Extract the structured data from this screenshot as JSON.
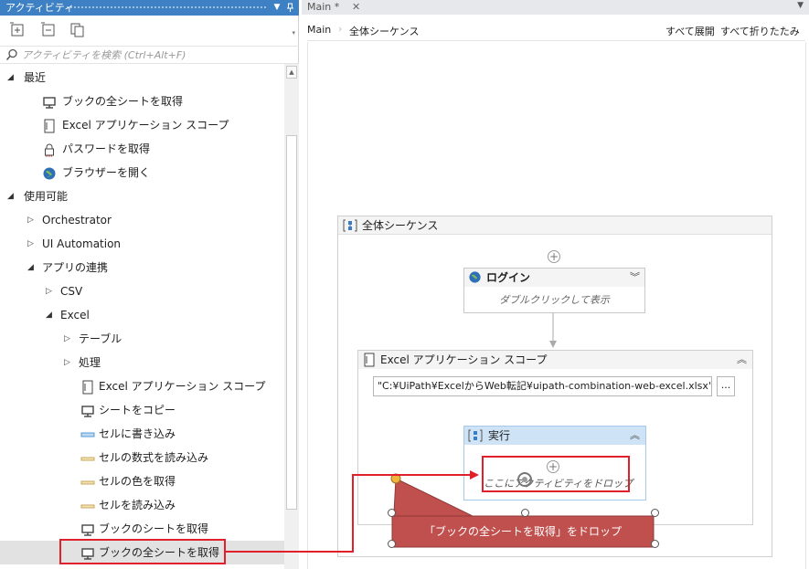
{
  "activities_panel": {
    "title": "アクティビティ",
    "search_placeholder": "アクティビティを検索 (Ctrl+Alt+F)",
    "toolbar": [
      "expand-all-icon",
      "collapse-all-icon",
      "copy-icon"
    ]
  },
  "tree": {
    "recent_label": "最近",
    "recent_items": [
      {
        "label": "ブックの全シートを取得",
        "icon": "monitor-icon"
      },
      {
        "label": "Excel アプリケーション スコープ",
        "icon": "document-icon"
      },
      {
        "label": "パスワードを取得",
        "icon": "lock-icon"
      },
      {
        "label": "ブラウザーを開く",
        "icon": "globe-icon"
      }
    ],
    "available_label": "使用可能",
    "orchestrator_label": "Orchestrator",
    "ui_automation_label": "UI Automation",
    "app_integration_label": "アプリの連携",
    "csv_label": "CSV",
    "excel_label": "Excel",
    "table_label": "テーブル",
    "process_label": "処理",
    "excel_items": [
      {
        "label": "Excel アプリケーション スコープ",
        "icon": "document-icon"
      },
      {
        "label": "シートをコピー",
        "icon": "monitor-icon"
      },
      {
        "label": "セルに書き込み",
        "icon": "cell-write-icon"
      },
      {
        "label": "セルの数式を読み込み",
        "icon": "cell-read-icon"
      },
      {
        "label": "セルの色を取得",
        "icon": "cell-read-icon"
      },
      {
        "label": "セルを読み込み",
        "icon": "cell-read-icon"
      },
      {
        "label": "ブックのシートを取得",
        "icon": "monitor-icon"
      },
      {
        "label": "ブックの全シートを取得",
        "icon": "monitor-icon"
      }
    ]
  },
  "designer": {
    "tab_label": "Main *",
    "breadcrumb": [
      "Main",
      "全体シーケンス"
    ],
    "expand_all": "すべて展開",
    "collapse_all": "すべて折りたたみ",
    "sequence_title": "全体シーケンス",
    "login_title": "ログイン",
    "login_hint": "ダブルクリックして表示",
    "excel_scope_title": "Excel アプリケーション スコープ",
    "excel_path": "\"C:¥UiPath¥ExcelからWeb転記¥uipath-combination-web-excel.xlsx\"",
    "browse_button": "...",
    "do_title": "実行",
    "drop_hint": "ここにアクティビティをドロップ",
    "callout_text": "「ブックの全シートを取得」をドロップ"
  },
  "colors": {
    "panel_title_bg": "#3d80c4",
    "highlight_red": "#e0202a",
    "callout_fill": "#c0504d",
    "do_header_bg": "#cfe3f6"
  }
}
